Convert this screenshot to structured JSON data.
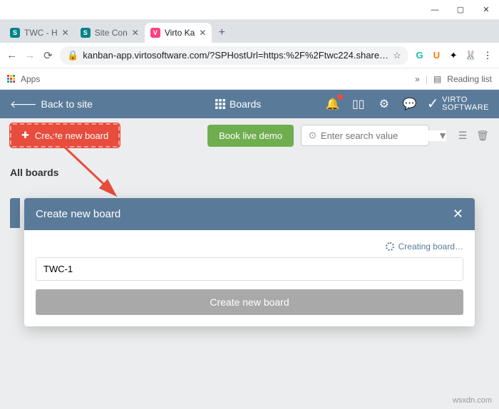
{
  "window": {
    "min": "—",
    "max": "▢",
    "close": "✕"
  },
  "tabs": [
    {
      "favClass": "fav-s",
      "favText": "S",
      "title": "TWC - H"
    },
    {
      "favClass": "fav-s",
      "favText": "S",
      "title": "Site Con"
    },
    {
      "favClass": "fav-v",
      "favText": "V",
      "title": "Virto Ka"
    }
  ],
  "browser": {
    "url": "kanban-app.virtosoftware.com/?SPHostUrl=https:%2F%2Ftwc224.share…",
    "apps": "Apps",
    "reading": "Reading list"
  },
  "topbar": {
    "back": "Back to site",
    "boards": "Boards",
    "logo1": "VIRTO",
    "logo2": "SOFTWARE"
  },
  "toolbar": {
    "create": "Create new board",
    "demo": "Book live demo",
    "search_placeholder": "Enter search value"
  },
  "content": {
    "all_boards": "All boards"
  },
  "modal": {
    "title": "Create new board",
    "creating": "Creating board…",
    "input_value": "TWC-1",
    "submit": "Create new board"
  },
  "watermark": "wsxdn.com"
}
